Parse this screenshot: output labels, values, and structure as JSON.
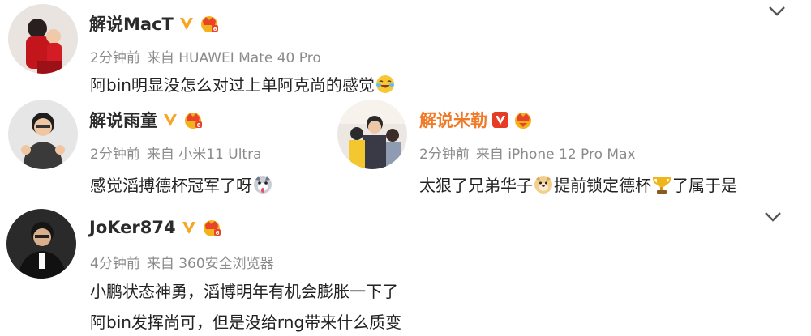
{
  "comments": [
    {
      "user": "解说MacT",
      "time": "2分钟前",
      "source": "来自 HUAWEI Mate 40 Pro",
      "text": "阿bin明显没怎么对过上单阿克尚的感觉"
    },
    {
      "user": "解说雨童",
      "time": "2分钟前",
      "source": "来自 小米11 Ultra",
      "text": "感觉滔搏德杯冠军了呀"
    },
    {
      "user": "解说米勒",
      "time": "2分钟前",
      "source": "来自 iPhone 12 Pro Max",
      "text_a": "太狠了兄弟华子",
      "text_b": "提前锁定德杯",
      "text_c": "了属于是"
    },
    {
      "user": "JoKer874",
      "time": "4分钟前",
      "source": "来自 360安全浏览器",
      "line1": "小鹏状态神勇，滔博明年有机会膨胀一下了",
      "line2": "阿bin发挥尚可，但是没给rng带来什么质变"
    }
  ],
  "colors": {
    "verified_gold": "#f5a623",
    "verified_red": "#e63b24",
    "name_orange": "#f07a27",
    "meta_gray": "#8b8b8b"
  },
  "icons": [
    "verified-v-icon",
    "crown-badge-icon",
    "laugh-cry-emoji",
    "dog-emoji",
    "trophy-emoji",
    "chevron-down-icon"
  ]
}
